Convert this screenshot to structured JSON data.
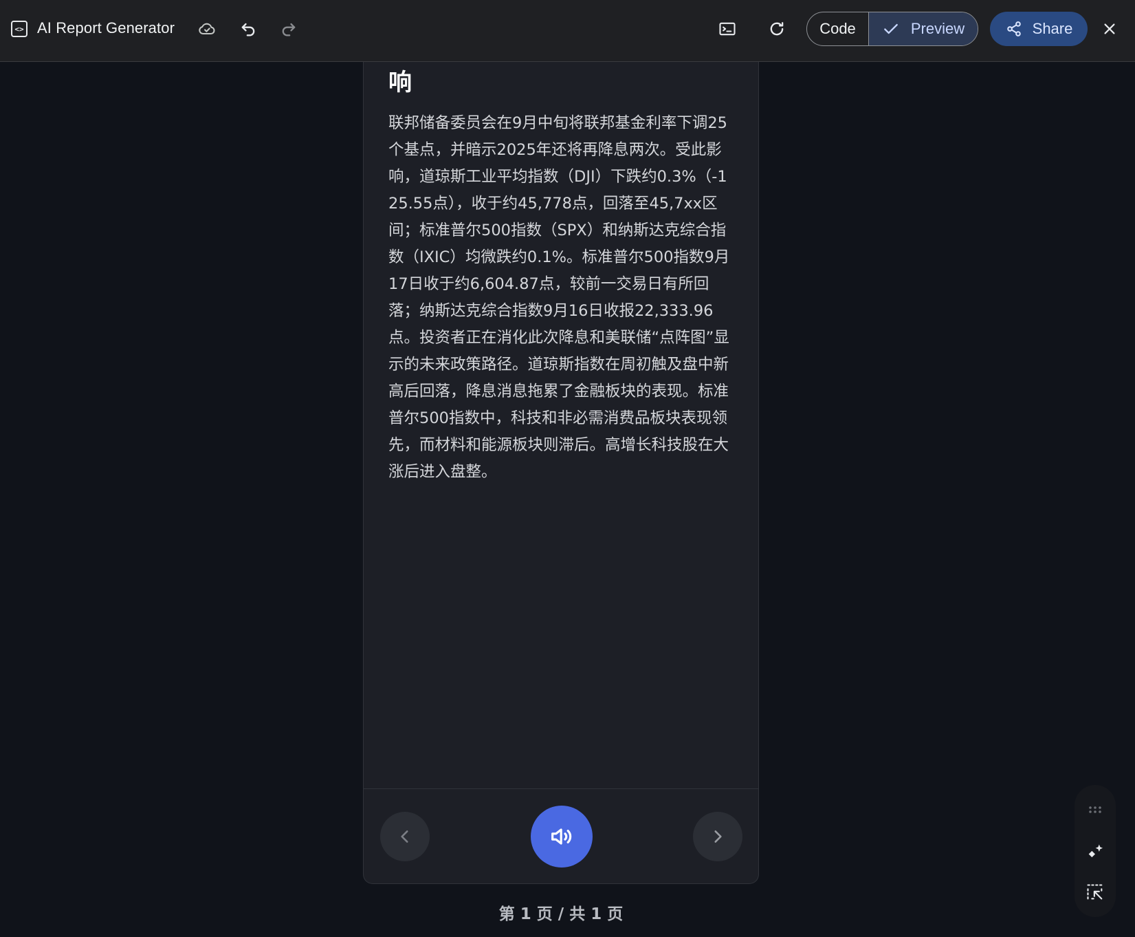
{
  "app": {
    "title": "AI Report Generator",
    "icon": "code-box-icon"
  },
  "toolbar": {
    "save_cloud_icon": "cloud-check-icon",
    "undo_icon": "undo-icon",
    "redo_icon": "redo-icon",
    "console_icon": "terminal-icon",
    "refresh_icon": "refresh-icon",
    "code_label": "Code",
    "preview_label": "Preview",
    "preview_selected": true,
    "share_label": "Share",
    "close_icon": "close-icon"
  },
  "report": {
    "heading": "响",
    "body": "联邦储备委员会在9月中旬将联邦基金利率下调25个基点，并暗示2025年还将再降息两次。受此影响，道琼斯工业平均指数（DJI）下跌约0.3%（-125.55点），收于约45,778点，回落至45,7xx区间；标准普尔500指数（SPX）和纳斯达克综合指数（IXIC）均微跌约0.1%。标准普尔500指数9月17日收于约6,604.87点，较前一交易日有所回落；纳斯达克综合指数9月16日收报22,333.96点。投资者正在消化此次降息和美联储“点阵图”显示的未来政策路径。道琼斯指数在周初触及盘中新高后回落，降息消息拖累了金融板块的表现。标准普尔500指数中，科技和非必需消费品板块表现领先，而材料和能源板块则滞后。高增长科技股在大涨后进入盘整。"
  },
  "pager": {
    "indicator": "第 1 页 / 共 1 页",
    "prev_icon": "chevron-left-icon",
    "next_icon": "chevron-right-icon",
    "audio_icon": "speaker-icon"
  },
  "floating_toolbar": {
    "drag_icon": "drag-handle-icon",
    "sparkle_icon": "sparkle-edit-icon",
    "select_icon": "select-element-icon"
  },
  "colors": {
    "accent": "#4a69e2",
    "share_bg": "#2a4a82",
    "background": "#10131a",
    "card": "#1d1f26"
  }
}
